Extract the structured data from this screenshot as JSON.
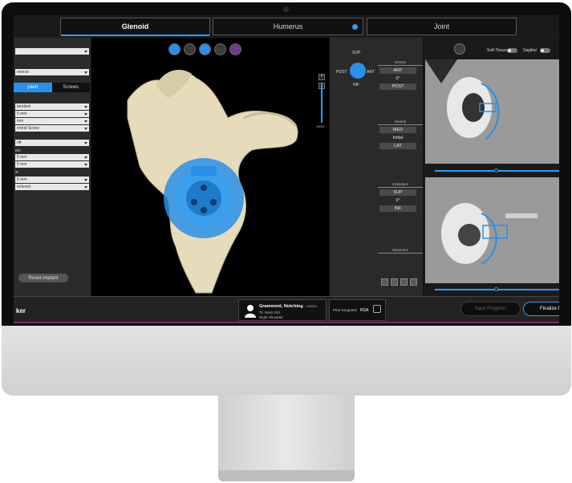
{
  "tabs": [
    {
      "label": "Glenoid",
      "active": true
    },
    {
      "label": "Humerus",
      "active": false
    },
    {
      "label": "Joint",
      "active": false
    }
  ],
  "left_panel": {
    "fields": [
      {
        "value": ""
      },
      {
        "value": "everse"
      },
      {
        "value": "tandard"
      },
      {
        "value": "5 mm"
      },
      {
        "value": "mm"
      },
      {
        "value": "entral Screw"
      },
      {
        "value": "oft"
      },
      {
        "value": "5 mm"
      },
      {
        "value": "5 mm"
      },
      {
        "value": "6 mm"
      },
      {
        "value": "entered"
      }
    ],
    "labels": [
      "ew",
      "w"
    ],
    "segment": [
      "plant",
      "Screws"
    ],
    "reset_label": "Reset implant"
  },
  "viewport": {
    "tools": [
      "scapula-view-icon",
      "implant-view-icon",
      "glenoid-view-icon",
      "bone-view-icon",
      "color-map-icon"
    ],
    "zoom_in": "+",
    "zoom_out": "-",
    "zoom_level": "100%"
  },
  "controls": {
    "directions": {
      "sup": "SUP",
      "inf": "INF",
      "ant": "ANT",
      "post": "POST"
    },
    "version": {
      "title": "Version",
      "btn_a": "ANT",
      "value": "0°",
      "btn_b": "POST"
    },
    "reaming": {
      "title": "Neutral",
      "btn_a": "MED",
      "value": "Initial",
      "btn_b": "LAT"
    },
    "inclination": {
      "title": "Inclination",
      "btn_a": "SUP",
      "value": "0°",
      "btn_b": "INF"
    },
    "measures_title": "Measures"
  },
  "right_panel": {
    "soft_tissue": "Soft-Tissue",
    "sagittal": "Sagittal"
  },
  "footer": {
    "brand": "ker",
    "patient_name": "Grammont, Notching",
    "patient_id": "- NS6RA",
    "patient_age": "75 Years Old",
    "patient_side": "Right Shoulder",
    "prior_label": "Prior Surgeries",
    "prior_value": "RSA",
    "save_label": "Save Progress",
    "finalize_label": "Finalize P"
  },
  "colors": {
    "accent": "#2a9dff",
    "bone": "#e6dcbc",
    "implant": "#2a8fe6"
  }
}
